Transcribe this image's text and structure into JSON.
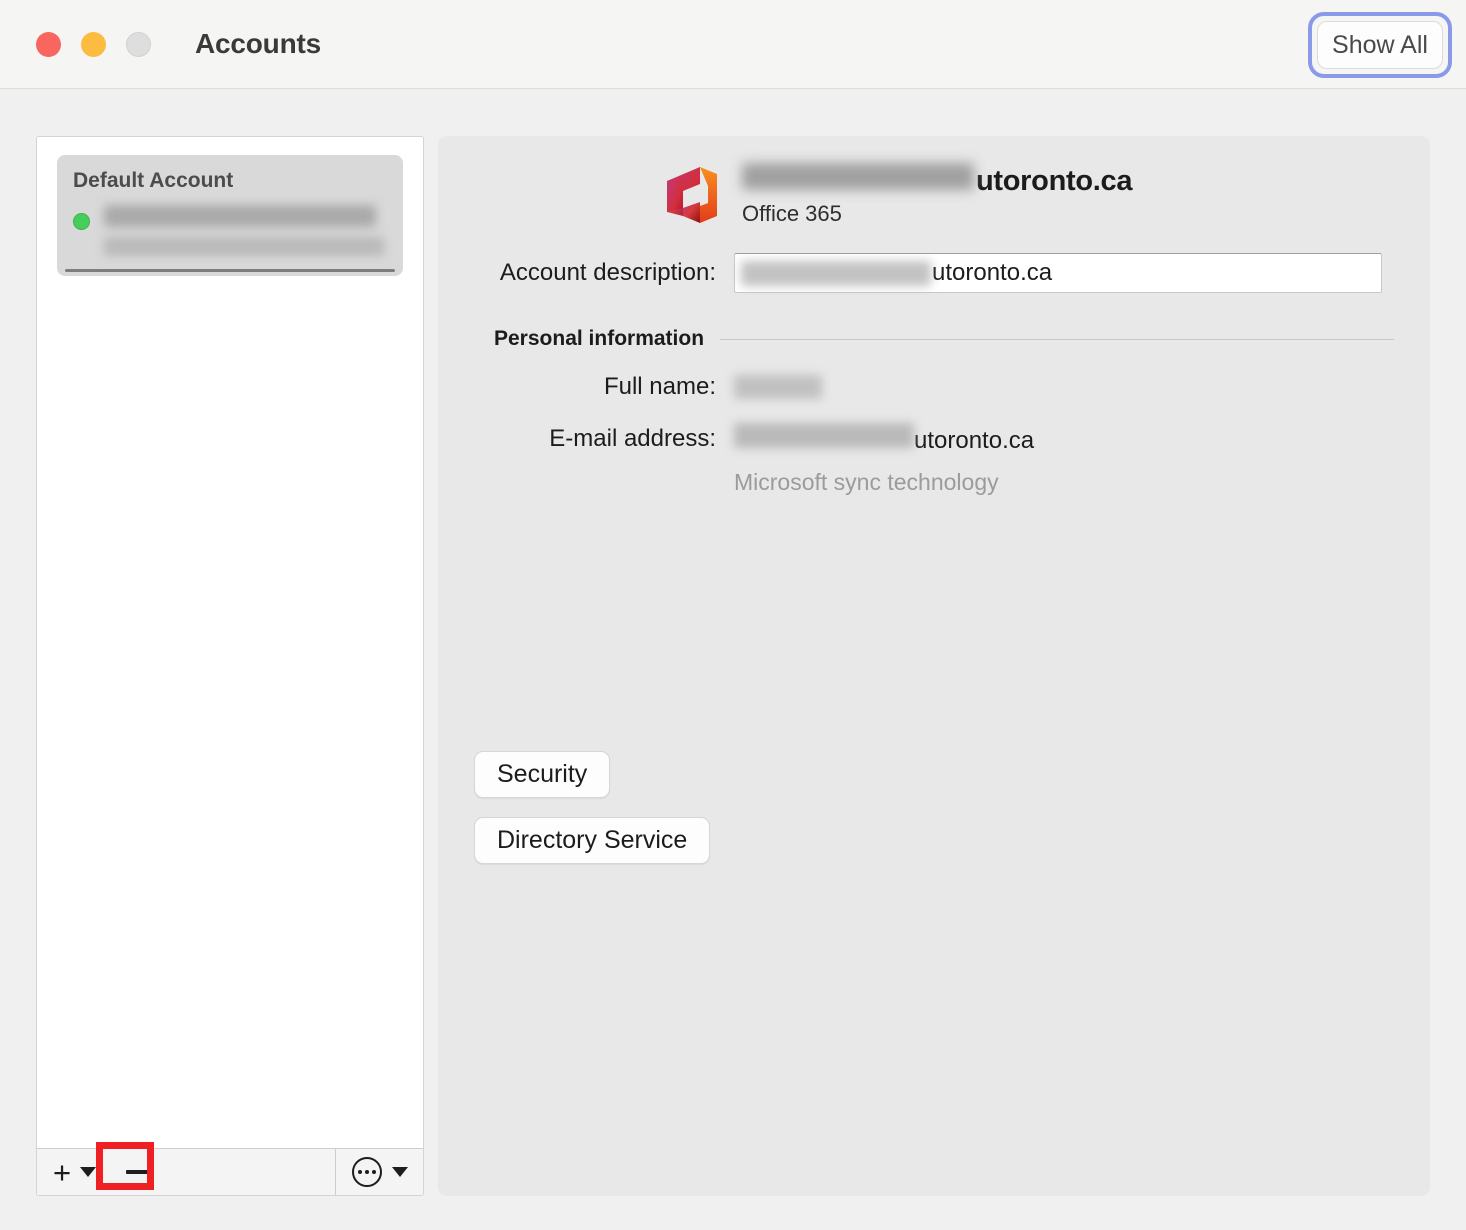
{
  "window": {
    "title": "Accounts",
    "traffic_lights": [
      {
        "name": "close",
        "color": "#f9655f"
      },
      {
        "name": "minimize",
        "color": "#fcbc40"
      },
      {
        "name": "zoom",
        "color": "#dedede"
      }
    ]
  },
  "toolbar": {
    "show_all_label": "Show All",
    "focus_ring_color": "#8b9ae8"
  },
  "sidebar": {
    "account": {
      "group_label": "Default Account",
      "status": "online",
      "status_color": "#46cd5c",
      "name_redacted": "",
      "email_redacted": ""
    },
    "bottom_toolbar": {
      "add_label": "+",
      "remove_label": "—",
      "more_label": "⋯",
      "highlight_color": "#ee2024",
      "highlighted_control": "remove-account-button"
    }
  },
  "detail": {
    "header": {
      "account_title_suffix": "utoronto.ca",
      "account_type": "Office 365",
      "logo": "office365-logo"
    },
    "account_description": {
      "label": "Account description:",
      "value_suffix": "utoronto.ca",
      "placeholder": "Account description"
    },
    "personal_information": {
      "section_title": "Personal information",
      "full_name": {
        "label": "Full name:",
        "value_redacted": ""
      },
      "email_address": {
        "label": "E-mail address:",
        "value_suffix": "utoronto.ca"
      },
      "sync_note": "Microsoft sync technology"
    },
    "actions": {
      "security_label": "Security",
      "directory_service_label": "Directory Service"
    }
  }
}
